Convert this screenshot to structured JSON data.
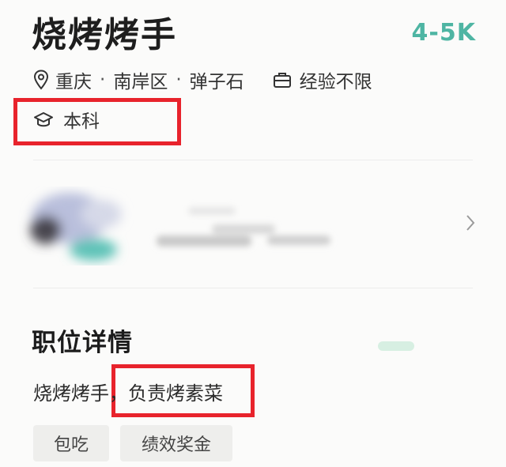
{
  "job": {
    "title": "烧烤烤手",
    "salary": "4-5K",
    "location": {
      "city": "重庆",
      "district": "南岸区",
      "area": "弹子石",
      "separator": "·"
    },
    "experience": "经验不限",
    "education": "本科"
  },
  "details": {
    "section_title": "职位详情",
    "description_prefix": "烧烤烤手，",
    "description_highlight": "负责烤素菜"
  },
  "tags": [
    {
      "label": "包吃"
    },
    {
      "label": "绩效奖金"
    }
  ],
  "colors": {
    "salary": "#4eb5a3",
    "highlight_box": "#e8232c",
    "tag_bg": "#eeeeec"
  },
  "icons": [
    "location-pin-icon",
    "briefcase-icon",
    "graduation-cap-icon",
    "chevron-right-icon"
  ]
}
